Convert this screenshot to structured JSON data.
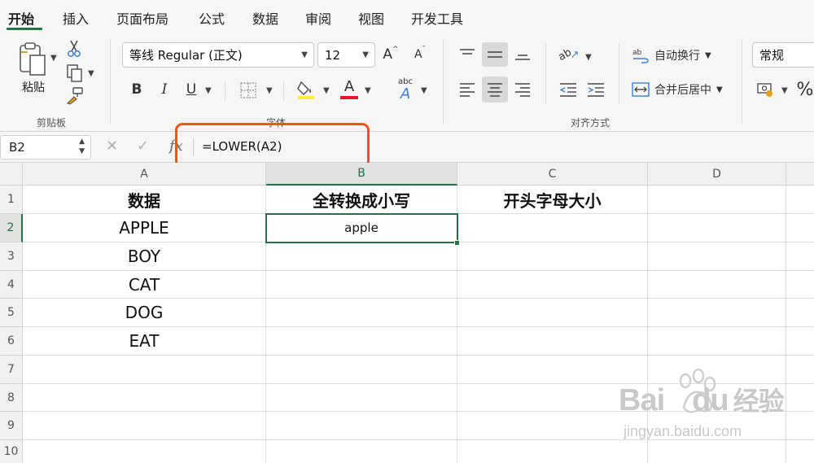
{
  "tabs": [
    "开始",
    "插入",
    "页面布局",
    "公式",
    "数据",
    "审阅",
    "视图",
    "开发工具"
  ],
  "ribbon": {
    "clipboard": {
      "paste_label": "粘贴",
      "group_label": "剪贴板"
    },
    "font": {
      "font_name": "等线 Regular (正文)",
      "font_size": "12",
      "bold": "B",
      "italic": "I",
      "underline": "U",
      "increase_font": "A",
      "decrease_font": "A",
      "font_color_letter": "A",
      "fill_color": "#ffeb3b",
      "font_color": "#e8152b",
      "phonetic_top": "abc",
      "phonetic_bottom": "A",
      "group_label": "字体"
    },
    "alignment": {
      "wrap_text": "自动换行",
      "merge_center": "合并后居中",
      "orientation_text": "ab",
      "group_label": "对齐方式"
    },
    "number": {
      "format": "常规",
      "percent": "%"
    }
  },
  "formula_bar": {
    "name_box": "B2",
    "cancel": "✕",
    "enter": "✓",
    "fx": "fx",
    "formula": "=LOWER(A2)"
  },
  "sheet": {
    "columns": [
      "A",
      "B",
      "C",
      "D"
    ],
    "rows": [
      "1",
      "2",
      "3",
      "4",
      "5",
      "6",
      "7",
      "8",
      "9",
      "10"
    ],
    "cells": {
      "A1": "数据",
      "B1": "全转换成小写",
      "C1": "开头字母大小",
      "A2": "APPLE",
      "B2": "apple",
      "A3": "BOY",
      "A4": "CAT",
      "A5": "DOG",
      "A6": "EAT"
    },
    "active_cell": "B2"
  },
  "watermark": {
    "brand": "Bai",
    "brand2": "du",
    "tail": "经验",
    "url": "jingyan.baidu.com"
  },
  "colors": {
    "accent": "#217346",
    "highlight_box": "#f0531f"
  }
}
